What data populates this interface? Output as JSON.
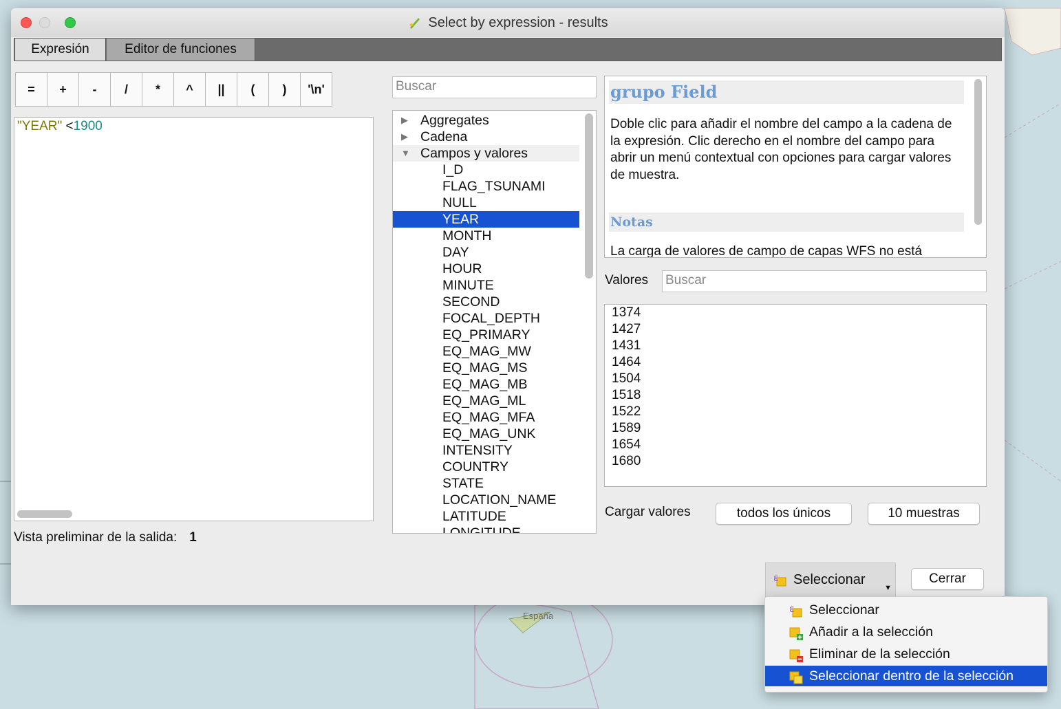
{
  "window": {
    "title": "Select by expression - results"
  },
  "tabs": [
    {
      "label": "Expresión"
    },
    {
      "label": "Editor de funciones"
    }
  ],
  "operators": [
    "=",
    "+",
    "-",
    "/",
    "*",
    "^",
    "||",
    "(",
    ")",
    "'\\n'"
  ],
  "expression": {
    "field": "\"YEAR\"",
    "operator": " <",
    "number": "1900"
  },
  "preview": {
    "label": "Vista preliminar de la salida:",
    "value": "1"
  },
  "search": {
    "placeholder": "Buscar"
  },
  "tree": {
    "groups": [
      {
        "label": "Aggregates",
        "expanded": false
      },
      {
        "label": "Cadena",
        "expanded": false
      },
      {
        "label": "Campos y valores",
        "expanded": true
      }
    ],
    "fields": [
      "I_D",
      "FLAG_TSUNAMI",
      "NULL",
      "YEAR",
      "MONTH",
      "DAY",
      "HOUR",
      "MINUTE",
      "SECOND",
      "FOCAL_DEPTH",
      "EQ_PRIMARY",
      "EQ_MAG_MW",
      "EQ_MAG_MS",
      "EQ_MAG_MB",
      "EQ_MAG_ML",
      "EQ_MAG_MFA",
      "EQ_MAG_UNK",
      "INTENSITY",
      "COUNTRY",
      "STATE",
      "LOCATION_NAME",
      "LATITUDE",
      "LONGITUDE"
    ],
    "selected_field": "YEAR"
  },
  "help": {
    "title": "grupo Field",
    "text": "Doble clic para añadir el nombre del campo a la cadena de la expresión. Clic derecho en el nombre del campo para abrir un menú contextual con opciones para cargar valores de muestra.",
    "notes_title": "Notas",
    "notes_text": "La carga de valores de campo de capas WFS no está"
  },
  "values": {
    "label": "Valores",
    "placeholder": "Buscar",
    "items": [
      "1374",
      "1427",
      "1431",
      "1464",
      "1504",
      "1518",
      "1522",
      "1589",
      "1654",
      "1680"
    ]
  },
  "load": {
    "label": "Cargar valores",
    "unique_label": "todos los únicos",
    "sample_label": "10 muestras"
  },
  "buttons": {
    "select_label": "Seleccionar",
    "close_label": "Cerrar"
  },
  "menu": {
    "items": [
      {
        "label": "Seleccionar"
      },
      {
        "label": "Añadir a la selección"
      },
      {
        "label": "Eliminar de la selección"
      },
      {
        "label": "Seleccionar dentro de la selección"
      }
    ],
    "highlighted_index": 3
  },
  "map": {
    "labels": [
      "España"
    ]
  }
}
